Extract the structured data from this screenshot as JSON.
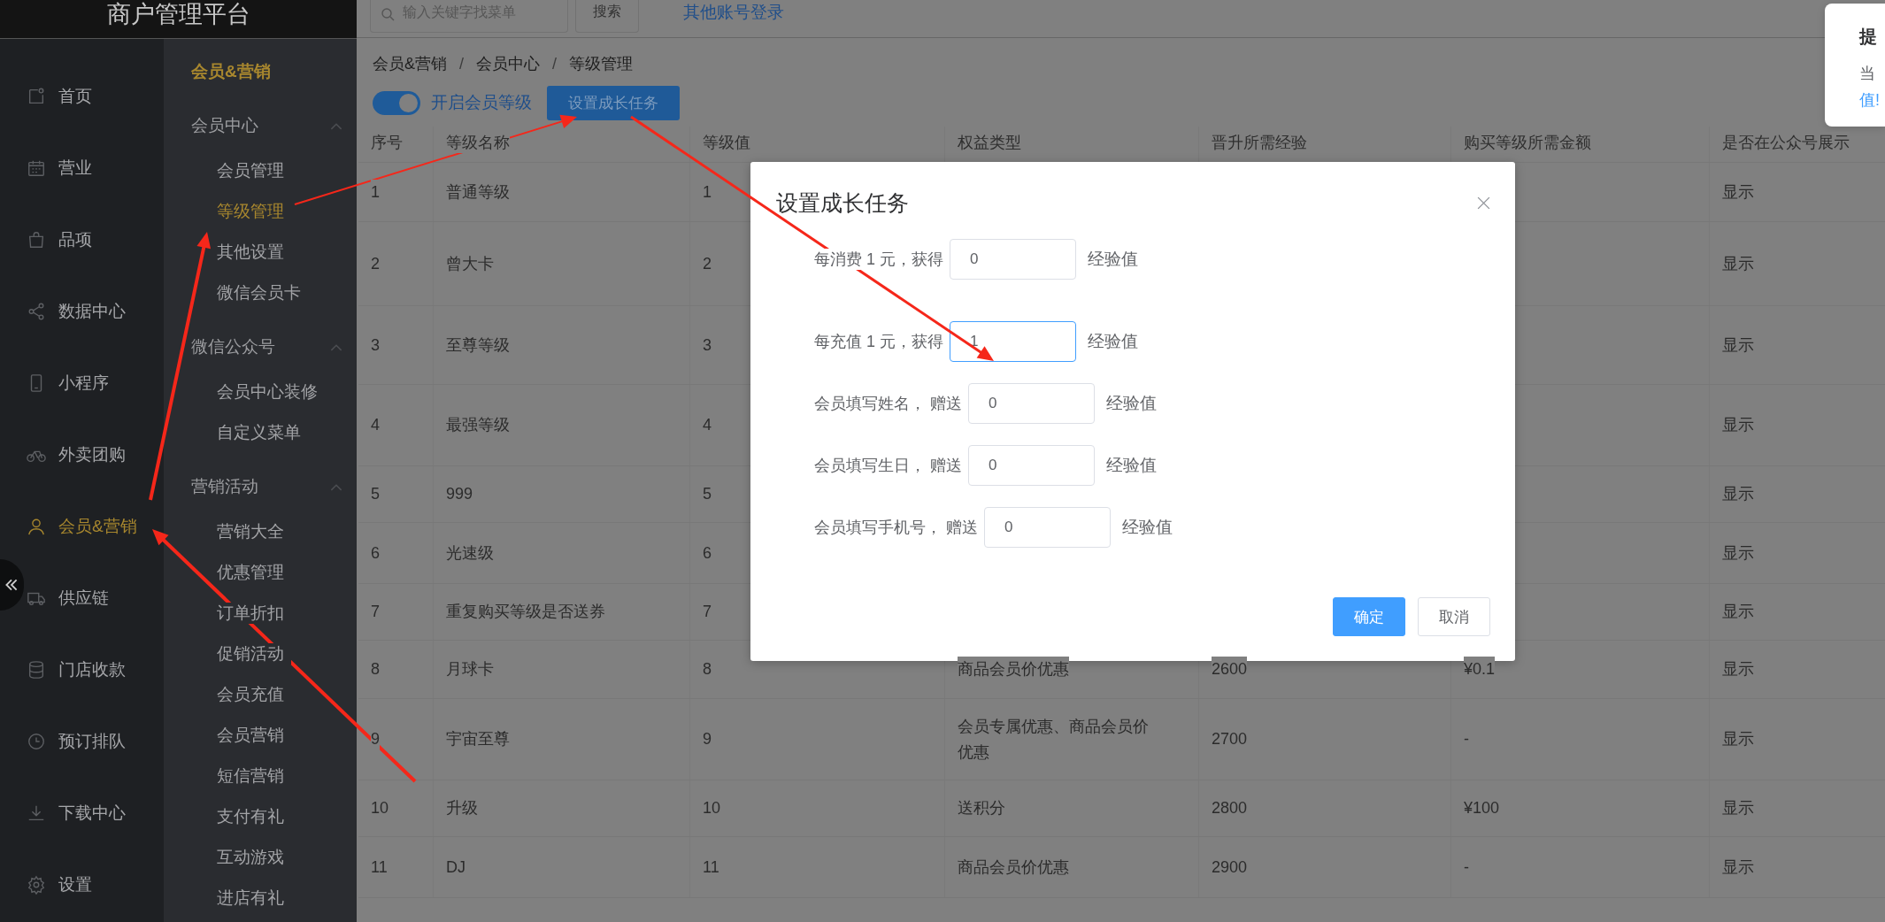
{
  "brand": {
    "title": "商户管理平台"
  },
  "top_bar": {
    "search": {
      "placeholder": "输入关键字找菜单"
    },
    "search_button": "搜索",
    "link": "其他账号登录"
  },
  "nav": {
    "items": [
      {
        "label": "首页",
        "selected": false
      },
      {
        "label": "营业",
        "selected": false
      },
      {
        "label": "品项",
        "selected": false
      },
      {
        "label": "数据中心",
        "selected": false
      },
      {
        "label": "小程序",
        "selected": false
      },
      {
        "label": "外卖团购",
        "selected": false
      },
      {
        "label": "会员&营销",
        "selected": true
      },
      {
        "label": "供应链",
        "selected": false
      },
      {
        "label": "门店收款",
        "selected": false
      },
      {
        "label": "预订排队",
        "selected": false
      },
      {
        "label": "下载中心",
        "selected": false
      },
      {
        "label": "设置",
        "selected": false
      }
    ]
  },
  "submenu": {
    "title": "会员&营销",
    "groups": [
      {
        "label": "会员中心",
        "expanded": true,
        "children": [
          {
            "label": "会员管理",
            "selected": false
          },
          {
            "label": "等级管理",
            "selected": true
          },
          {
            "label": "其他设置",
            "selected": false
          },
          {
            "label": "微信会员卡",
            "selected": false
          }
        ]
      },
      {
        "label": "微信公众号",
        "expanded": true,
        "children": [
          {
            "label": "会员中心装修",
            "selected": false
          },
          {
            "label": "自定义菜单",
            "selected": false
          }
        ]
      },
      {
        "label": "营销活动",
        "expanded": true,
        "children": [
          {
            "label": "营销大全",
            "selected": false
          },
          {
            "label": "优惠管理",
            "selected": false
          },
          {
            "label": "订单折扣",
            "selected": false
          },
          {
            "label": "促销活动",
            "selected": false
          },
          {
            "label": "会员充值",
            "selected": false
          },
          {
            "label": "会员营销",
            "selected": false
          },
          {
            "label": "短信营销",
            "selected": false
          },
          {
            "label": "支付有礼",
            "selected": false
          },
          {
            "label": "互动游戏",
            "selected": false
          },
          {
            "label": "进店有礼",
            "selected": false
          }
        ]
      }
    ]
  },
  "breadcrumb": {
    "items": [
      "会员&营销",
      "会员中心",
      "等级管理"
    ],
    "separators": [
      "/",
      "/"
    ]
  },
  "toolbar": {
    "toggle": {
      "label": "开启会员等级",
      "on": true
    },
    "button": "设置成长任务"
  },
  "table": {
    "columns": [
      "序号",
      "等级名称",
      "等级值",
      "权益类型",
      "晋升所需经验",
      "购买等级所需金额",
      "是否在公众号展示"
    ],
    "rows": [
      {
        "cells": [
          "1",
          "普通等级",
          "1",
          null,
          null,
          null,
          "显示"
        ]
      },
      {
        "cells": [
          "2",
          "曾大卡",
          "2",
          null,
          null,
          null,
          "显示"
        ]
      },
      {
        "cells": [
          "3",
          "至尊等级",
          "3",
          null,
          null,
          null,
          "显示"
        ]
      },
      {
        "cells": [
          "4",
          "最强等级",
          "4",
          null,
          null,
          null,
          "显示"
        ]
      },
      {
        "cells": [
          "5",
          "999",
          "5",
          null,
          null,
          null,
          "显示"
        ]
      },
      {
        "cells": [
          "6",
          "光速级",
          "6",
          null,
          null,
          null,
          "显示"
        ]
      },
      {
        "cells": [
          "7",
          "重复购买等级是否送券",
          "7",
          null,
          null,
          null,
          "显示"
        ]
      },
      {
        "cells": [
          "8",
          "月球卡",
          "8",
          "商品会员价优惠",
          "2600",
          "¥0.1",
          "显示"
        ]
      },
      {
        "cells": [
          "9",
          "宇宙至尊",
          "9",
          "会员专属优惠、商品会员价优惠",
          "2700",
          "-",
          "显示"
        ]
      },
      {
        "cells": [
          "10",
          "升级",
          "10",
          "送积分",
          "2800",
          "¥100",
          "显示"
        ]
      },
      {
        "cells": [
          "11",
          "DJ",
          "11",
          "商品会员价优惠",
          "2900",
          "-",
          "显示"
        ]
      }
    ]
  },
  "dialog": {
    "title": "设置成长任务",
    "fields": [
      {
        "label": "每消费 1 元，获得",
        "value": "0",
        "unit": "经验值",
        "focused": false
      },
      {
        "label": "每充值 1 元，获得",
        "value": "1",
        "unit": "经验值",
        "focused": true
      },
      {
        "label": "会员填写姓名， 赠送",
        "value": "0",
        "unit": "经验值",
        "focused": false
      },
      {
        "label": "会员填写生日， 赠送",
        "value": "0",
        "unit": "经验值",
        "focused": false
      },
      {
        "label": "会员填写手机号， 赠送",
        "value": "0",
        "unit": "经验值",
        "focused": false
      }
    ],
    "buttons": [
      {
        "label": "确定",
        "kind": "primary"
      },
      {
        "label": "取消",
        "kind": "default"
      }
    ]
  },
  "toast": {
    "title": "提",
    "message": "当",
    "link": "值!"
  }
}
